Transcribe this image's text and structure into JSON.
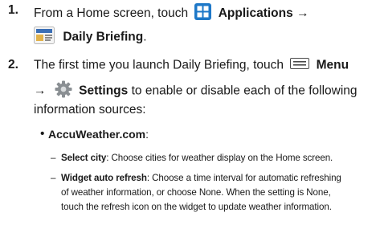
{
  "steps": [
    {
      "number": "1.",
      "lead": "From a Home screen, touch",
      "applications": "Applications",
      "arrow": "→",
      "daily_briefing": "Daily Briefing",
      "period": "."
    },
    {
      "number": "2.",
      "lead": "The first time you launch Daily Briefing, touch",
      "menu": "Menu",
      "arrow": "→",
      "settings": "Settings",
      "tail": "to enable or disable each of the following",
      "tail2": "information sources:"
    }
  ],
  "source": {
    "bullet": "•",
    "name": "AccuWeather.com",
    "colon": ":",
    "items": [
      {
        "dash": "–",
        "term": "Select city",
        "desc": ": Choose cities for weather display on the Home screen."
      },
      {
        "dash": "–",
        "term": "Widget auto refresh",
        "desc1": ": Choose a time interval for automatic refreshing",
        "desc2": "of weather information, or choose None. When the setting is None,",
        "desc3": "touch the refresh icon on the widget to update weather information."
      }
    ]
  },
  "colors": {
    "apps_icon": "#1e78c8",
    "menu_icon": "#4a4a4a",
    "settings_icon": "#8a8f93"
  },
  "icons": [
    "applications-icon",
    "daily-briefing-icon",
    "menu-icon",
    "settings-icon"
  ]
}
